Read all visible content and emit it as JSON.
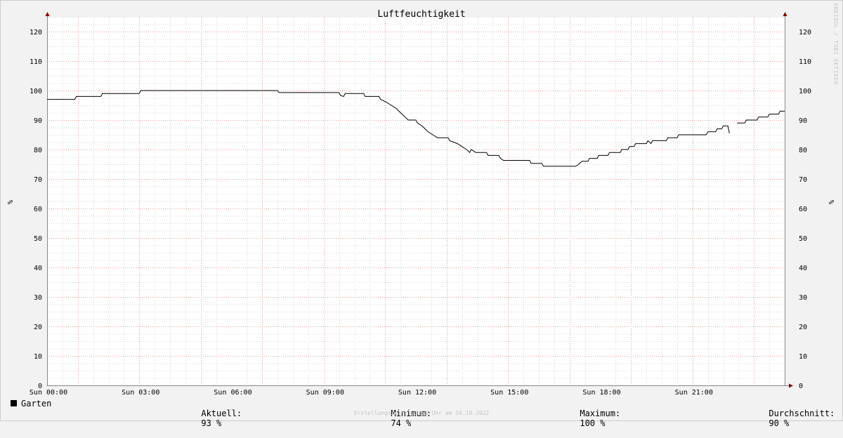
{
  "chart_data": {
    "type": "line",
    "title": "Luftfeuchtigkeit",
    "ylabel": "%",
    "ylim": [
      0,
      125
    ],
    "y_ticks": [
      0,
      10,
      20,
      30,
      40,
      50,
      60,
      70,
      80,
      90,
      100,
      110,
      120
    ],
    "x_tick_labels": [
      "Sun 00:00",
      "Sun 03:00",
      "Sun 06:00",
      "Sun 09:00",
      "Sun 12:00",
      "Sun 15:00",
      "Sun 18:00",
      "Sun 21:00"
    ],
    "x_range_hours": [
      0,
      24
    ],
    "grid": true,
    "series": [
      {
        "name": "Garten",
        "color": "#000000",
        "points": [
          [
            0.0,
            97
          ],
          [
            0.9,
            97
          ],
          [
            0.95,
            98
          ],
          [
            1.75,
            98
          ],
          [
            1.8,
            99
          ],
          [
            3.0,
            99
          ],
          [
            3.05,
            100
          ],
          [
            7.5,
            100
          ],
          [
            7.55,
            99.3
          ],
          [
            9.5,
            99.3
          ],
          [
            9.55,
            98.3
          ],
          [
            9.65,
            98
          ],
          [
            9.7,
            99
          ],
          [
            10.3,
            99
          ],
          [
            10.35,
            98
          ],
          [
            10.8,
            98
          ],
          [
            10.85,
            97
          ],
          [
            11.05,
            96
          ],
          [
            11.2,
            95
          ],
          [
            11.35,
            94
          ],
          [
            11.45,
            93
          ],
          [
            11.55,
            92
          ],
          [
            11.65,
            91
          ],
          [
            11.75,
            90
          ],
          [
            12.0,
            90
          ],
          [
            12.05,
            89
          ],
          [
            12.2,
            88
          ],
          [
            12.3,
            87
          ],
          [
            12.4,
            86
          ],
          [
            12.55,
            85
          ],
          [
            12.7,
            84
          ],
          [
            13.05,
            84
          ],
          [
            13.1,
            83
          ],
          [
            13.35,
            82
          ],
          [
            13.5,
            81
          ],
          [
            13.65,
            80
          ],
          [
            13.75,
            79
          ],
          [
            13.8,
            80
          ],
          [
            13.95,
            79
          ],
          [
            14.3,
            79
          ],
          [
            14.35,
            78
          ],
          [
            14.7,
            78
          ],
          [
            14.75,
            77
          ],
          [
            14.85,
            76.3
          ],
          [
            15.7,
            76.3
          ],
          [
            15.75,
            75.3
          ],
          [
            16.1,
            75.3
          ],
          [
            16.15,
            74.3
          ],
          [
            17.2,
            74.3
          ],
          [
            17.3,
            75
          ],
          [
            17.4,
            76
          ],
          [
            17.6,
            76
          ],
          [
            17.65,
            77
          ],
          [
            17.9,
            77
          ],
          [
            17.95,
            78
          ],
          [
            18.25,
            78
          ],
          [
            18.3,
            79
          ],
          [
            18.65,
            79
          ],
          [
            18.7,
            80
          ],
          [
            18.9,
            80
          ],
          [
            18.95,
            81
          ],
          [
            19.1,
            81
          ],
          [
            19.15,
            82
          ],
          [
            19.5,
            82
          ],
          [
            19.55,
            83
          ],
          [
            19.65,
            82
          ],
          [
            19.7,
            83
          ],
          [
            20.15,
            83
          ],
          [
            20.2,
            84
          ],
          [
            20.5,
            84
          ],
          [
            20.55,
            85
          ],
          [
            21.45,
            85
          ],
          [
            21.5,
            86
          ],
          [
            21.75,
            86
          ],
          [
            21.8,
            87
          ],
          [
            21.95,
            87
          ],
          [
            22.0,
            88
          ],
          [
            22.15,
            88
          ],
          [
            22.2,
            85.5
          ],
          null,
          [
            22.45,
            89
          ],
          [
            22.7,
            89
          ],
          [
            22.75,
            90
          ],
          [
            23.1,
            90
          ],
          [
            23.15,
            91
          ],
          [
            23.45,
            91
          ],
          [
            23.5,
            92
          ],
          [
            23.8,
            92
          ],
          [
            23.85,
            93
          ],
          [
            24.0,
            93
          ]
        ]
      }
    ]
  },
  "legend": {
    "series_name": "Garten",
    "current_label": "Aktuell:",
    "current_value": "93 %",
    "min_label": "Minimum:",
    "min_value": "74 %",
    "max_label": "Maximum:",
    "max_value": "100 %",
    "avg_label": "Durchschnitt:",
    "avg_value": "90 %"
  },
  "footer": "Erstellungszeit: 23:55 Uhr am 16.10.2022",
  "watermark": "RRDTOOL / TOBI OETIKER",
  "colors": {
    "background": "#f2f2f2",
    "plot_area": "#ffffff",
    "minor_grid": "#d9d9d9",
    "major_grid": "#e8a0a0",
    "axis": "#888888",
    "arrow": "#8b0000",
    "line": "#000000"
  }
}
